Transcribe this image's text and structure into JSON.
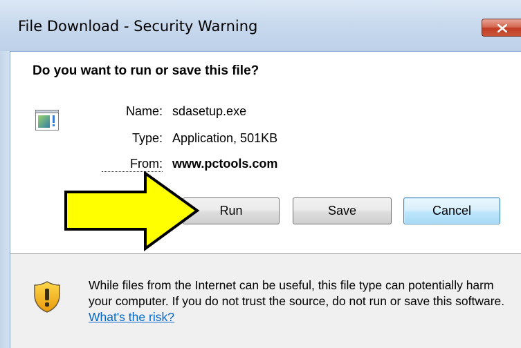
{
  "window": {
    "title": "File Download - Security Warning",
    "close_label": "close"
  },
  "dialog": {
    "question": "Do you want to run or save this file?",
    "file": {
      "name_label": "Name:",
      "name_value": "sdasetup.exe",
      "type_label": "Type:",
      "type_value": "Application, 501KB",
      "from_label": "From:",
      "from_value": "www.pctools.com"
    },
    "buttons": {
      "run": "Run",
      "save": "Save",
      "cancel": "Cancel"
    },
    "warning": {
      "text": "While files from the Internet can be useful, this file type can potentially harm your computer. If you do not trust the source, do not run or save this software.",
      "link": "What's the risk?"
    }
  },
  "colors": {
    "arrow_fill": "#ffff00",
    "link": "#0066cc",
    "close_button": "#c23c22"
  },
  "icons": [
    "application-file-icon",
    "close-icon",
    "shield-warning-icon",
    "yellow-arrow"
  ]
}
